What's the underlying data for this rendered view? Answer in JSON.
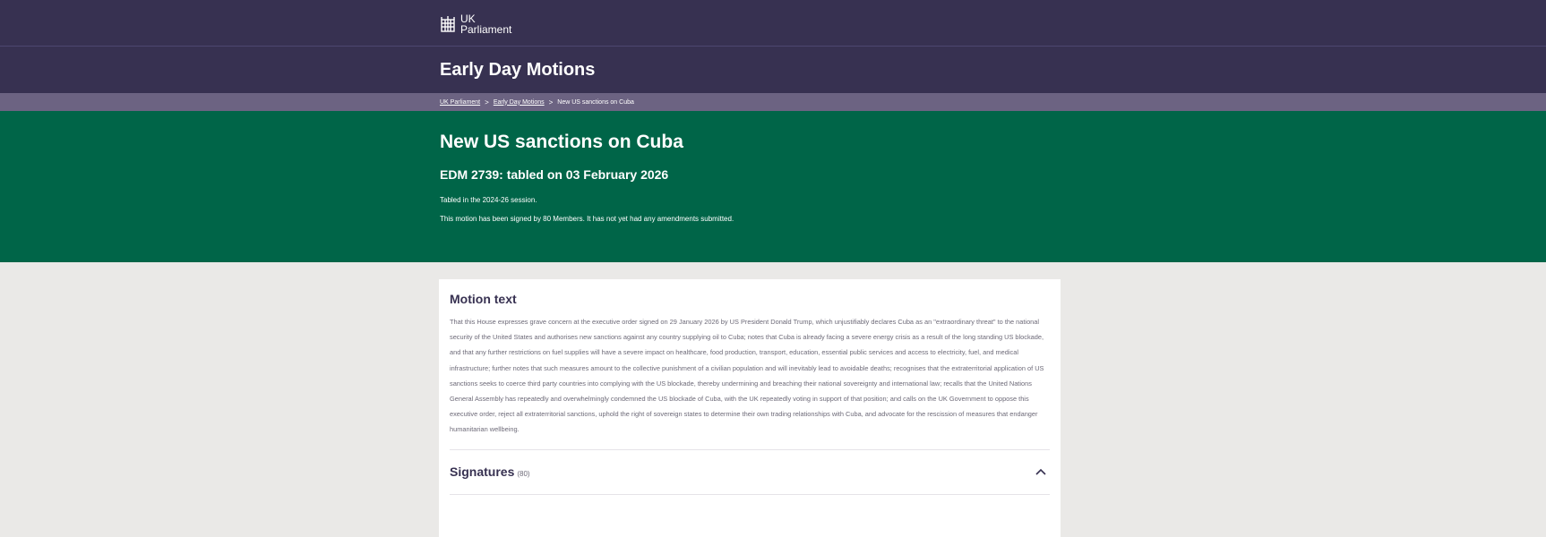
{
  "header": {
    "logo_line1": "UK",
    "logo_line2": "Parliament"
  },
  "section": {
    "title": "Early Day Motions"
  },
  "breadcrumb": {
    "items": [
      "UK Parliament",
      "Early Day Motions"
    ],
    "separator": ">",
    "current": "New US sanctions on Cuba"
  },
  "motion": {
    "title": "New US sanctions on Cuba",
    "subtitle": "EDM 2739: tabled on 03 February 2026",
    "session_note": "Tabled in the 2024-26 session.",
    "signed_note": "This motion has been signed by 80 Members. It has not yet had any amendments submitted.",
    "text_heading": "Motion text",
    "text": "That this House expresses grave concern at the executive order signed on 29 January 2026 by US President Donald Trump, which unjustifiably declares Cuba as an \"extraordinary threat\" to the national security of the United States and authorises new sanctions against any country supplying oil to Cuba; notes that Cuba is already facing a severe energy crisis as a result of the long standing US blockade, and that any further restrictions on fuel supplies will have a severe impact on healthcare, food production, transport, education, essential public services and access to electricity, fuel, and medical infrastructure; further notes that such measures amount to the collective punishment of a civilian population and will inevitably lead to avoidable deaths; recognises that the extraterritorial application of US sanctions seeks to coerce third party countries into complying with the US blockade, thereby undermining and breaching their national sovereignty and international law; recalls that the United Nations General Assembly has repeatedly and overwhelmingly condemned the US blockade of Cuba, with the UK repeatedly voting in support of that position; and calls on the UK Government to oppose this executive order, reject all extraterritorial sanctions, uphold the right of sovereign states to determine their own trading relationships with Cuba, and advocate for the rescission of measures that endanger humanitarian wellbeing."
  },
  "signatures": {
    "label": "Signatures",
    "count": "(80)"
  },
  "colors": {
    "header_bg": "#373151",
    "breadcrumb_bg": "#6c6382",
    "hero_bg": "#006548",
    "page_bg": "#eae9e7"
  },
  "icons": {
    "logo": "portcullis-icon",
    "signatures_toggle": "chevron-up-icon"
  }
}
